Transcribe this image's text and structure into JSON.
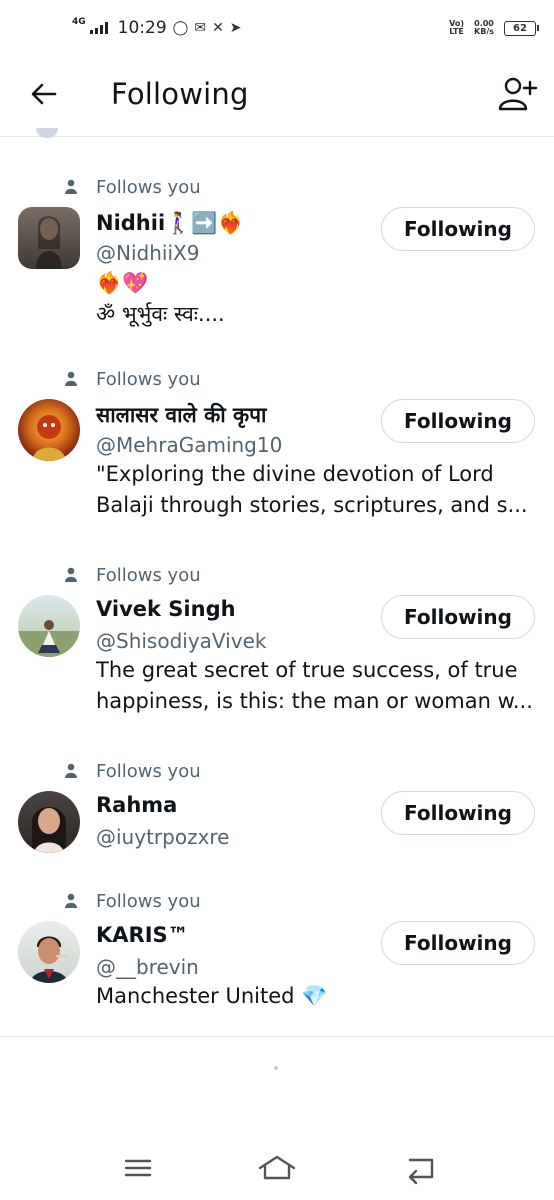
{
  "status_bar": {
    "network": "4G",
    "time": "10:29",
    "carrier_line1": "Vo)",
    "carrier_line2": "LTE",
    "speed_value": "0.00",
    "speed_unit": "KB/s",
    "battery": "62"
  },
  "header": {
    "title": "Following"
  },
  "follows_you_label": "Follows you",
  "button_label": "Following",
  "users": [
    {
      "name": "Nidhii🚶‍♀️➡️❤️‍🔥",
      "handle": "@NidhiiX9",
      "bio": [
        "❤️‍🔥💖",
        "ॐ भूर्भुवः स्वः...."
      ]
    },
    {
      "name": "सालासर वाले की कृपा",
      "handle": "@MehraGaming10",
      "bio": [
        "\"Exploring the divine devotion of Lord",
        "Balaji through stories, scriptures, and s..."
      ]
    },
    {
      "name": "Vivek Singh",
      "handle": "@ShisodiyaVivek",
      "bio": [
        "The great secret of true success, of true",
        "happiness, is this: the man or woman w..."
      ]
    },
    {
      "name": "Rahma",
      "handle": "@iuytrpozxre",
      "bio": []
    },
    {
      "name": "KARIS™",
      "handle": "@__brevin",
      "bio": [
        "Manchester United 💎"
      ]
    }
  ]
}
